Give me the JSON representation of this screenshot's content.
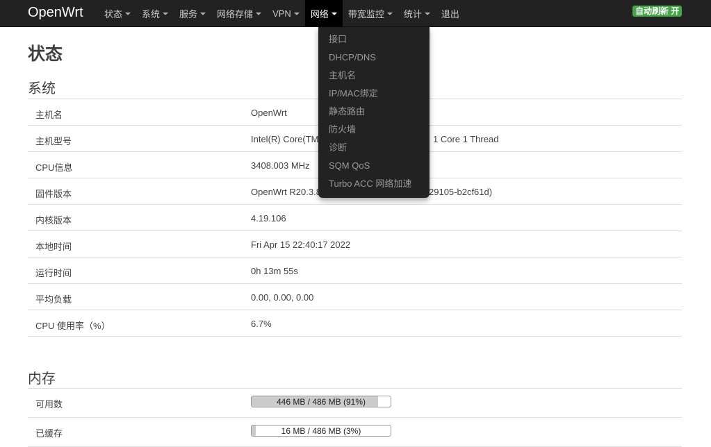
{
  "navbar": {
    "brand": "OpenWrt",
    "items": [
      {
        "label": "状态",
        "has_caret": true
      },
      {
        "label": "系统",
        "has_caret": true
      },
      {
        "label": "服务",
        "has_caret": true
      },
      {
        "label": "网络存储",
        "has_caret": true
      },
      {
        "label": "VPN",
        "has_caret": true
      },
      {
        "label": "网络",
        "has_caret": true,
        "active": true
      },
      {
        "label": "带宽监控",
        "has_caret": true
      },
      {
        "label": "统计",
        "has_caret": true
      },
      {
        "label": "退出",
        "has_caret": false
      }
    ],
    "refresh_badge": "自动刷新 开"
  },
  "dropdown": {
    "items": [
      "接口",
      "DHCP/DNS",
      "主机名",
      "IP/MAC绑定",
      "静态路由",
      "防火墙",
      "诊断",
      "SQM QoS",
      "Turbo ACC 网络加速"
    ]
  },
  "page": {
    "title": "状态",
    "system_section": "系统",
    "memory_section": "内存"
  },
  "system": {
    "rows": [
      {
        "label": "主机名",
        "value": "OpenWrt"
      },
      {
        "label": "主机型号",
        "value": "Intel(R) Core(TM",
        "value_tail": "1 Core 1 Thread"
      },
      {
        "label": "CPU信息",
        "value": "3408.003 MHz"
      },
      {
        "label": "固件版本",
        "value": "OpenWrt R20.3.8",
        "value_tail": "29105-b2cf61d)"
      },
      {
        "label": "内核版本",
        "value": "4.19.106"
      },
      {
        "label": "本地时间",
        "value": "Fri Apr 15 22:40:17 2022"
      },
      {
        "label": "运行时间",
        "value": "0h 13m 55s"
      },
      {
        "label": "平均负载",
        "value": "0.00, 0.00, 0.00"
      },
      {
        "label": "CPU 使用率（%）",
        "value": "6.7%"
      }
    ]
  },
  "memory": {
    "rows": [
      {
        "label": "可用数",
        "bar_text": "446 MB / 486 MB (91%)",
        "percent": 91
      },
      {
        "label": "已缓存",
        "bar_text": "16 MB / 486 MB (3%)",
        "percent": 3
      }
    ]
  },
  "colors": {
    "navbar_bg": "#222222",
    "badge_green": "#46a546",
    "bar_fill": "#cccccc"
  }
}
